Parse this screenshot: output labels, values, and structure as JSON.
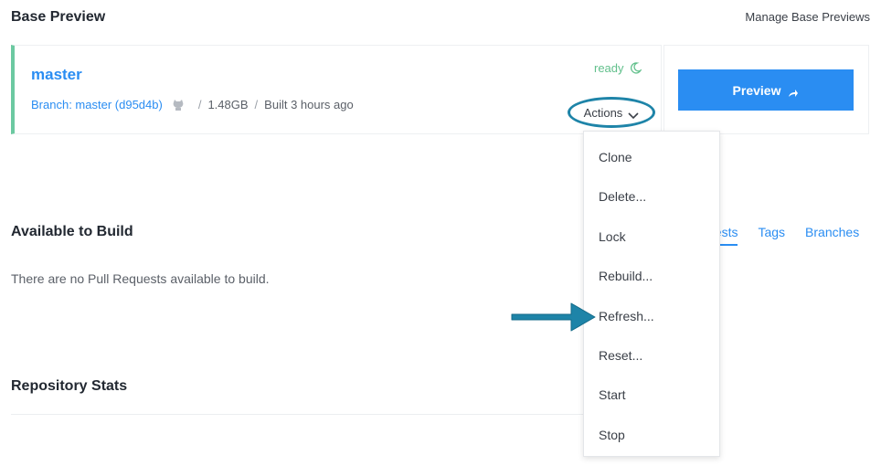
{
  "header": {
    "title": "Base Preview",
    "manage_link": "Manage Base Previews"
  },
  "base_preview": {
    "branch_name": "master",
    "branch_label": "Branch: master",
    "commit": "(d95d4b)",
    "size": "1.48GB",
    "built": "Built 3 hours ago",
    "status": "ready",
    "actions_label": "Actions",
    "preview_label": "Preview"
  },
  "available": {
    "title": "Available to Build",
    "tabs": [
      "uests",
      "Tags",
      "Branches"
    ],
    "empty_message": "There are no Pull Requests available to build."
  },
  "repo_stats": {
    "title": "Repository Stats"
  },
  "actions_menu": {
    "items": [
      "Clone",
      "Delete...",
      "Lock",
      "Rebuild...",
      "Refresh...",
      "Reset...",
      "Start",
      "Stop"
    ]
  },
  "colors": {
    "accent": "#2a8df2",
    "status_green": "#62c08c",
    "highlight": "#1e84a8",
    "card_border_left": "#6cc9a1"
  }
}
